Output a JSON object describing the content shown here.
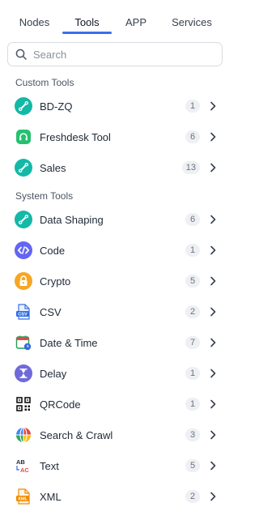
{
  "tabs": [
    {
      "label": "Nodes"
    },
    {
      "label": "Tools"
    },
    {
      "label": "APP"
    },
    {
      "label": "Services"
    }
  ],
  "search": {
    "placeholder": "Search"
  },
  "custom_tools": {
    "title": "Custom Tools",
    "items": [
      {
        "label": "BD-ZQ",
        "count": "1",
        "icon": "plug-icon"
      },
      {
        "label": "Freshdesk Tool",
        "count": "6",
        "icon": "freshdesk-icon"
      },
      {
        "label": "Sales",
        "count": "13",
        "icon": "plug-icon"
      }
    ]
  },
  "system_tools": {
    "title": "System Tools",
    "items": [
      {
        "label": "Data Shaping",
        "count": "6",
        "icon": "plug-icon"
      },
      {
        "label": "Code",
        "count": "1",
        "icon": "code-icon"
      },
      {
        "label": "Crypto",
        "count": "5",
        "icon": "lock-icon"
      },
      {
        "label": "CSV",
        "count": "2",
        "icon": "csv-icon"
      },
      {
        "label": "Date & Time",
        "count": "7",
        "icon": "calendar-icon"
      },
      {
        "label": "Delay",
        "count": "1",
        "icon": "hourglass-icon"
      },
      {
        "label": "QRCode",
        "count": "1",
        "icon": "qrcode-icon"
      },
      {
        "label": "Search & Crawl",
        "count": "3",
        "icon": "globe-icon"
      },
      {
        "label": "Text",
        "count": "5",
        "icon": "text-icon"
      },
      {
        "label": "XML",
        "count": "2",
        "icon": "xml-icon"
      }
    ]
  },
  "colors": {
    "accent": "#3b6fe6",
    "teal": "#14b8a6",
    "freshdesk": "#25c16f"
  }
}
